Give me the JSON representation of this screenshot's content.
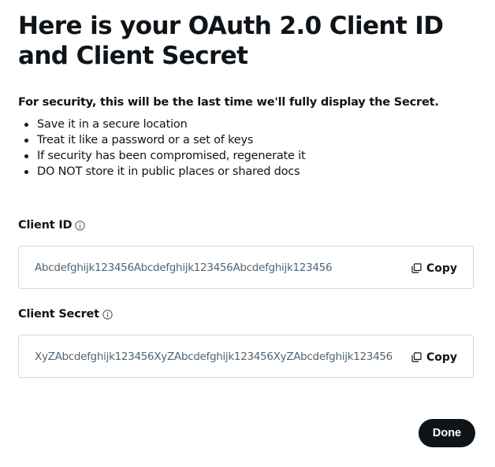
{
  "dialog": {
    "title": "Here is your OAuth 2.0 Client ID and Client Secret",
    "security_note": "For security, this will be the last time we'll fully display the Secret.",
    "tips": [
      "Save it in a secure location",
      "Treat it like a password or a set of keys",
      "If security has been compromised, regenerate it",
      "DO NOT store it in public places or shared docs"
    ]
  },
  "client_id": {
    "label": "Client ID",
    "value": "Abcdefghijk123456Abcdefghijk123456Abcdefghijk123456",
    "copy_label": "Copy",
    "info_icon": "info-icon",
    "copy_icon": "copy-icon"
  },
  "client_secret": {
    "label": "Client Secret",
    "value": "XyZAbcdefghijk123456XyZAbcdefghijk123456XyZAbcdefghijk123456",
    "copy_label": "Copy",
    "info_icon": "info-icon",
    "copy_icon": "copy-icon"
  },
  "actions": {
    "done_label": "Done"
  },
  "colors": {
    "text_primary": "#0f1419",
    "text_secondary": "#536471",
    "border": "#cfd9de",
    "button_bg": "#0f1419",
    "button_text": "#ffffff"
  }
}
